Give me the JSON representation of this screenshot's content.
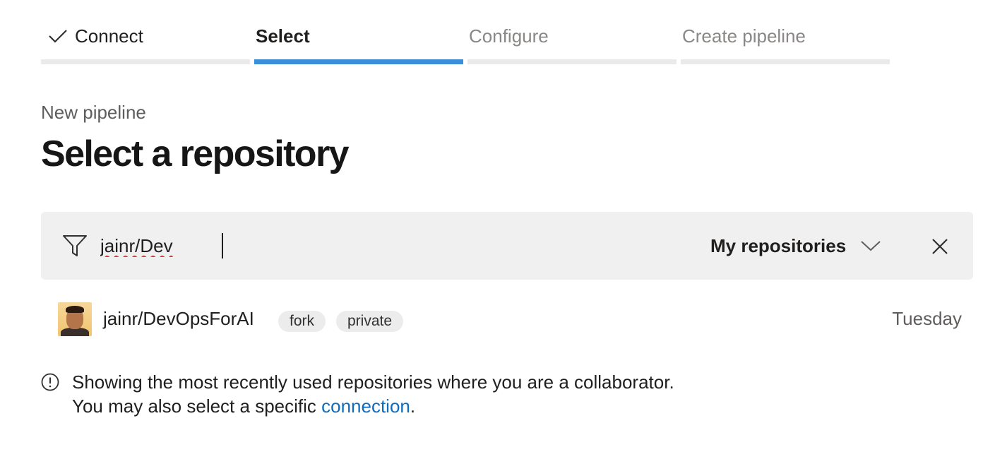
{
  "stepper": {
    "steps": [
      {
        "label": "Connect",
        "state": "done",
        "icon": "check-icon"
      },
      {
        "label": "Select",
        "state": "active"
      },
      {
        "label": "Configure",
        "state": "pending"
      },
      {
        "label": "Create pipeline",
        "state": "pending"
      }
    ],
    "active_color": "#3b8fd9"
  },
  "header": {
    "subtitle": "New pipeline",
    "title": "Select a repository"
  },
  "filter": {
    "icon": "filter-icon",
    "value": "jainr/Dev",
    "scope_label": "My repositories",
    "scope_icon": "chevron-down-icon",
    "clear_icon": "close-icon"
  },
  "repositories": [
    {
      "name": "jainr/DevOpsForAI",
      "tags": [
        "fork",
        "private"
      ],
      "date": "Tuesday"
    }
  ],
  "info": {
    "icon": "info-icon",
    "line1": "Showing the most recently used repositories where you are a collaborator.",
    "line2_prefix": "You may also select a specific ",
    "link_text": "connection",
    "line2_suffix": ".",
    "link_color": "#0f6cbd"
  }
}
